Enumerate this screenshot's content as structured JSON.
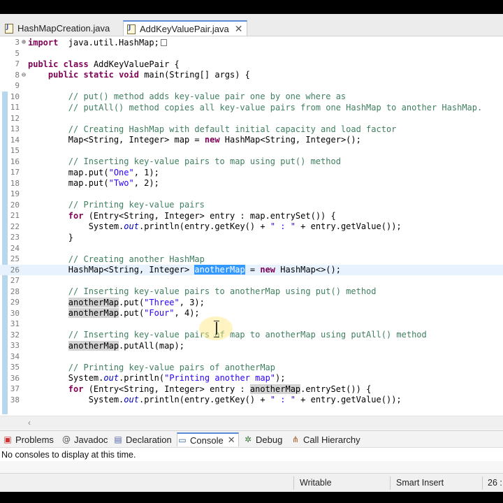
{
  "tabs": [
    {
      "label": "HashMapCreation.java",
      "active": false
    },
    {
      "label": "AddKeyValuePair.java",
      "active": true,
      "close": "✕"
    }
  ],
  "lines": [
    {
      "n": "3",
      "fold": "⊕",
      "tokens": [
        [
          "kw",
          "import"
        ],
        [
          "",
          "  java.util.HashMap;"
        ]
      ],
      "collapsed": true
    },
    {
      "n": "5",
      "tokens": []
    },
    {
      "n": "7",
      "tokens": [
        [
          "kw",
          "public"
        ],
        [
          "kw",
          " class"
        ],
        [
          "",
          " AddKeyValuePair {"
        ]
      ]
    },
    {
      "n": "8",
      "fold": "⊖",
      "tokens": [
        [
          "",
          "    "
        ],
        [
          "kw",
          "public"
        ],
        [
          "kw",
          " static"
        ],
        [
          "kw",
          " void"
        ],
        [
          "",
          " main(String[] args) {"
        ]
      ]
    },
    {
      "n": "9",
      "tokens": []
    },
    {
      "n": "10",
      "tokens": [
        [
          "",
          "        "
        ],
        [
          "cm",
          "// put() method adds key-value pair one by one where as"
        ]
      ]
    },
    {
      "n": "11",
      "tokens": [
        [
          "",
          "        "
        ],
        [
          "cm",
          "// putAll() method copies all key-value pairs from one HashMap to another HashMap."
        ]
      ]
    },
    {
      "n": "12",
      "tokens": []
    },
    {
      "n": "13",
      "tokens": [
        [
          "",
          "        "
        ],
        [
          "cm",
          "// Creating HashMap with default initial capacity and load factor"
        ]
      ]
    },
    {
      "n": "14",
      "tokens": [
        [
          "",
          "        Map<String, Integer> map = "
        ],
        [
          "kw",
          "new"
        ],
        [
          "",
          " HashMap<String, Integer>();"
        ]
      ]
    },
    {
      "n": "15",
      "tokens": []
    },
    {
      "n": "16",
      "tokens": [
        [
          "",
          "        "
        ],
        [
          "cm",
          "// Inserting key-value pairs to map using put() method"
        ]
      ]
    },
    {
      "n": "17",
      "tokens": [
        [
          "",
          "        map.put("
        ],
        [
          "str",
          "\"One\""
        ],
        [
          "",
          ", 1);"
        ]
      ]
    },
    {
      "n": "18",
      "tokens": [
        [
          "",
          "        map.put("
        ],
        [
          "str",
          "\"Two\""
        ],
        [
          "",
          ", 2);"
        ]
      ]
    },
    {
      "n": "19",
      "tokens": []
    },
    {
      "n": "20",
      "tokens": [
        [
          "",
          "        "
        ],
        [
          "cm",
          "// Printing key-value pairs"
        ]
      ]
    },
    {
      "n": "21",
      "tokens": [
        [
          "",
          "        "
        ],
        [
          "kw",
          "for"
        ],
        [
          "",
          " (Entry<String, Integer> entry : map.entrySet()) {"
        ]
      ]
    },
    {
      "n": "22",
      "tokens": [
        [
          "",
          "            System."
        ],
        [
          "st",
          "out"
        ],
        [
          "",
          ".println(entry.getKey() + "
        ],
        [
          "str",
          "\" : \""
        ],
        [
          "",
          " + entry.getValue());"
        ]
      ]
    },
    {
      "n": "23",
      "tokens": [
        [
          "",
          "        }"
        ]
      ]
    },
    {
      "n": "24",
      "tokens": []
    },
    {
      "n": "25",
      "tokens": [
        [
          "",
          "        "
        ],
        [
          "cm",
          "// Creating another HashMap"
        ]
      ]
    },
    {
      "n": "26",
      "current": true,
      "tokens": [
        [
          "",
          "        HashMap<String, Integer> "
        ],
        [
          "sel",
          "anotherMap"
        ],
        [
          "",
          " = "
        ],
        [
          "kw",
          "new"
        ],
        [
          "",
          " HashMap<>();"
        ]
      ]
    },
    {
      "n": "27",
      "tokens": []
    },
    {
      "n": "28",
      "tokens": [
        [
          "",
          "        "
        ],
        [
          "cm",
          "// Inserting key-value pairs to anotherMap using put() method"
        ]
      ]
    },
    {
      "n": "29",
      "tokens": [
        [
          "",
          "        "
        ],
        [
          "ref",
          "anotherMap"
        ],
        [
          "",
          ".put("
        ],
        [
          "str",
          "\"Three\""
        ],
        [
          "",
          ", 3);"
        ]
      ]
    },
    {
      "n": "30",
      "tokens": [
        [
          "",
          "        "
        ],
        [
          "ref",
          "anotherMap"
        ],
        [
          "",
          ".put("
        ],
        [
          "str",
          "\"Four\""
        ],
        [
          "",
          ", 4);"
        ]
      ]
    },
    {
      "n": "31",
      "tokens": []
    },
    {
      "n": "32",
      "tokens": [
        [
          "",
          "        "
        ],
        [
          "cm",
          "// Inserting key-value pairs of map to anotherMap using putAll() method"
        ]
      ]
    },
    {
      "n": "33",
      "tokens": [
        [
          "",
          "        "
        ],
        [
          "ref",
          "anotherMap"
        ],
        [
          "",
          ".putAll(map);"
        ]
      ]
    },
    {
      "n": "34",
      "tokens": []
    },
    {
      "n": "35",
      "tokens": [
        [
          "",
          "        "
        ],
        [
          "cm",
          "// Printing key-value pairs of anotherMap"
        ]
      ]
    },
    {
      "n": "36",
      "tokens": [
        [
          "",
          "        System."
        ],
        [
          "st",
          "out"
        ],
        [
          "",
          ".println("
        ],
        [
          "str",
          "\"Printing another map\""
        ],
        [
          "",
          ");"
        ]
      ]
    },
    {
      "n": "37",
      "tokens": [
        [
          "",
          "        "
        ],
        [
          "kw",
          "for"
        ],
        [
          "",
          " (Entry<String, Integer> entry : "
        ],
        [
          "ref",
          "anotherMap"
        ],
        [
          "",
          ".entrySet()) {"
        ]
      ]
    },
    {
      "n": "38",
      "tokens": [
        [
          "",
          "            System."
        ],
        [
          "st",
          "out"
        ],
        [
          "",
          ".println(entry.getKey() + "
        ],
        [
          "str",
          "\" : \""
        ],
        [
          "",
          " + entry.getValue());"
        ]
      ]
    }
  ],
  "views": {
    "tabs": [
      {
        "label": "Problems",
        "icon": "problems-icon"
      },
      {
        "label": "Javadoc",
        "icon": "at-icon"
      },
      {
        "label": "Declaration",
        "icon": "declaration-icon"
      },
      {
        "label": "Console",
        "icon": "console-icon",
        "active": true,
        "close": "✕"
      },
      {
        "label": "Debug",
        "icon": "bug-icon"
      },
      {
        "label": "Call Hierarchy",
        "icon": "hierarchy-icon"
      }
    ],
    "console_message": "No consoles to display at this time."
  },
  "status": {
    "mode": "Writable",
    "insert": "Smart Insert",
    "position": "26 :"
  },
  "colors": {
    "keyword": "#7f0055",
    "comment": "#3f7f5f",
    "string": "#2a00ff",
    "selection": "#3399ff",
    "current_line": "#e8f2fe"
  }
}
